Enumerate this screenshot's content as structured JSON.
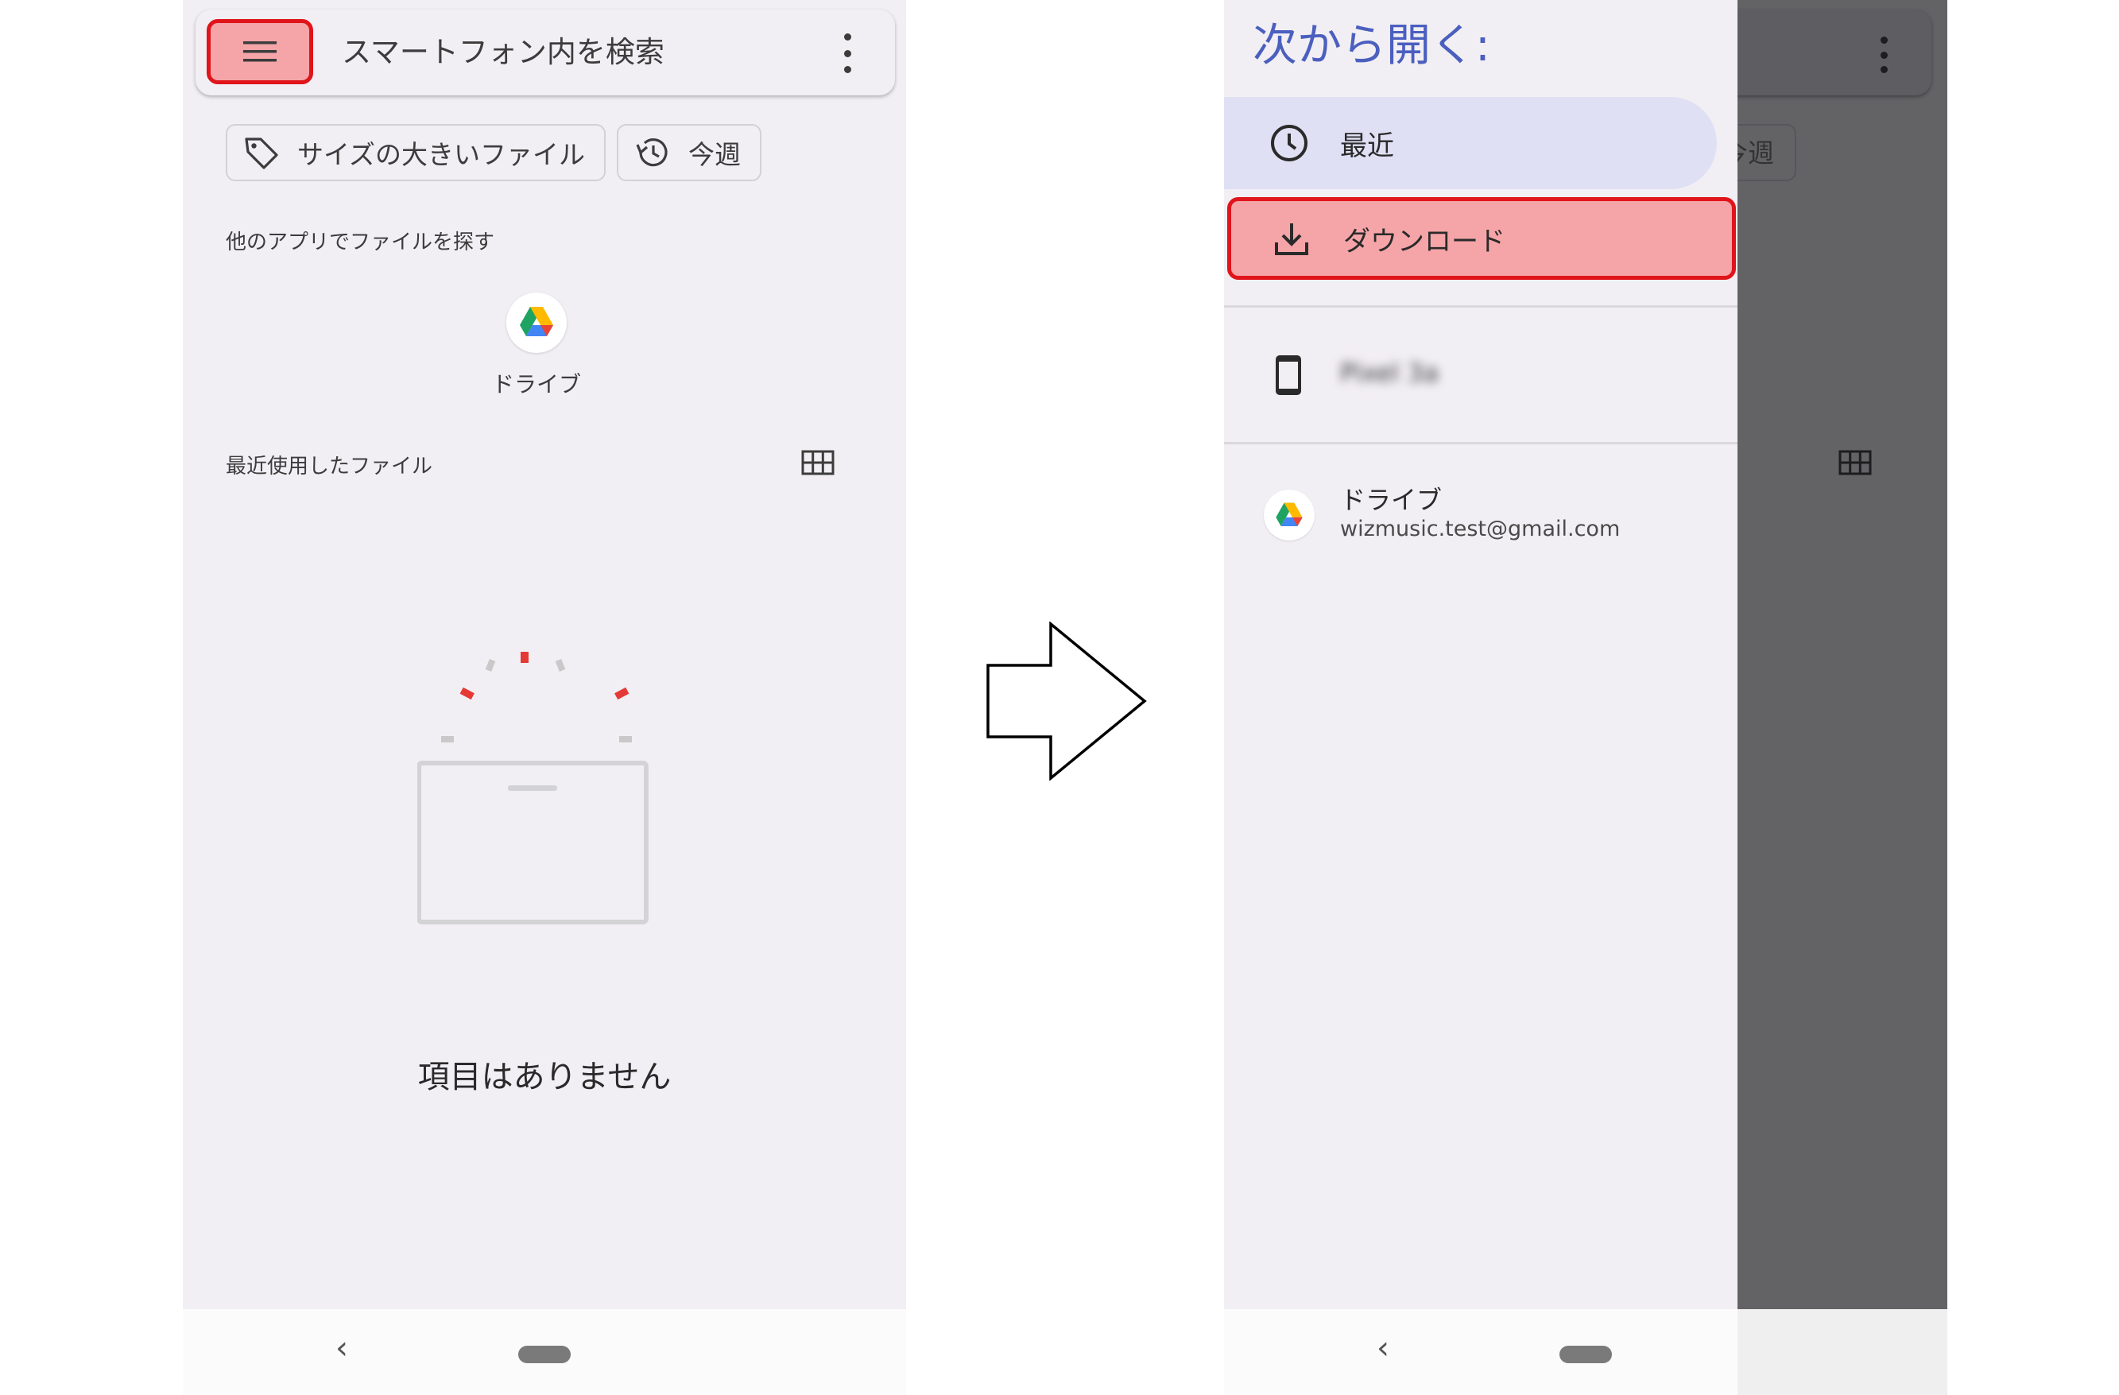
{
  "left_screen": {
    "search": {
      "placeholder": "スマートフォン内を検索"
    },
    "chips": [
      {
        "label": "サイズの大きいファイル",
        "icon": "tag-icon"
      },
      {
        "label": "今週",
        "icon": "history-icon"
      }
    ],
    "other_apps_heading": "他のアプリでファイルを探す",
    "drive_app_label": "ドライブ",
    "recent_files_heading": "最近使用したファイル",
    "empty_message": "項目はありません"
  },
  "right_screen": {
    "drawer_title": "次から開く:",
    "items": [
      {
        "label": "最近",
        "icon": "clock-icon",
        "selected": true
      },
      {
        "label": "ダウンロード",
        "icon": "download-icon",
        "highlighted": true
      },
      {
        "label": "Pixel 3a",
        "icon": "phone-icon",
        "blurred": true
      }
    ],
    "drive": {
      "title": "ドライブ",
      "account": "wizmusic.test@gmail.com"
    },
    "background_chip_label": "今週"
  },
  "colors": {
    "highlight_fill": "#f5a5a8",
    "highlight_border": "#e0141b",
    "accent_title": "#4b5fbf",
    "selected_item_bg": "#dfe0f4",
    "scrim": "#636366"
  }
}
